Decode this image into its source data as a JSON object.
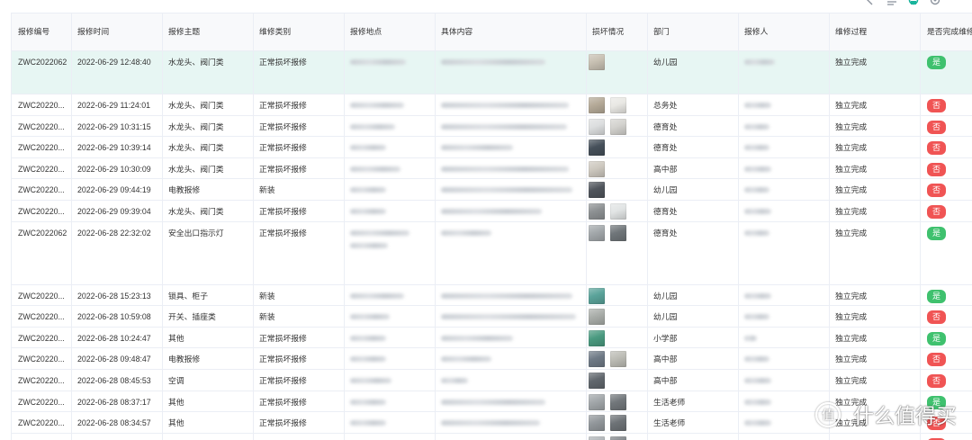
{
  "toolbar": {
    "icons": [
      "prev-icon",
      "density-icon",
      "refresh-icon",
      "settings-icon"
    ],
    "accent": "#19b49c"
  },
  "columns": [
    "报修编号",
    "报修时间",
    "报修主题",
    "维修类别",
    "报修地点",
    "具体内容",
    "损坏情况",
    "部门",
    "报修人",
    "维修过程",
    "是否完成维修"
  ],
  "status_colors": {
    "是": "#3fc16e",
    "否": "#f05454"
  },
  "selected_row_color": "#e7f6f3",
  "rows": [
    {
      "id": "ZWC2022062",
      "time": "2022-06-29 12:48:40",
      "subject": "水龙头、阀门类",
      "category": "正常损坏报修",
      "photos": [
        "#c7c0b2"
      ],
      "dept": "幼儿园",
      "process": "独立完成",
      "done": "是",
      "selected": true
    },
    {
      "id": "ZWC20220...",
      "time": "2022-06-29 11:24:01",
      "subject": "水龙头、阀门类",
      "category": "正常损坏报修",
      "photos": [
        "#b5aa98",
        "#e9e8e4"
      ],
      "dept": "总务处",
      "process": "独立完成",
      "done": "否"
    },
    {
      "id": "ZWC20220...",
      "time": "2022-06-29 10:31:15",
      "subject": "水龙头、阀门类",
      "category": "正常损坏报修",
      "photos": [
        "#dcdedf",
        "#d3d2ce"
      ],
      "dept": "德育处",
      "process": "独立完成",
      "done": "否"
    },
    {
      "id": "ZWC20220...",
      "time": "2022-06-29 10:39:14",
      "subject": "水龙头、阀门类",
      "category": "正常损坏报修",
      "photos": [
        "#46505a"
      ],
      "dept": "德育处",
      "process": "独立完成",
      "done": "否"
    },
    {
      "id": "ZWC20220...",
      "time": "2022-06-29 10:30:09",
      "subject": "水龙头、阀门类",
      "category": "正常损坏报修",
      "photos": [
        "#cdc8bf"
      ],
      "dept": "高中部",
      "process": "独立完成",
      "done": "否"
    },
    {
      "id": "ZWC20220...",
      "time": "2022-06-29 09:44:19",
      "subject": "电教报修",
      "category": "新装",
      "photos": [
        "#50555c"
      ],
      "dept": "幼儿园",
      "process": "独立完成",
      "done": "否"
    },
    {
      "id": "ZWC20220...",
      "time": "2022-06-29 09:39:04",
      "subject": "水龙头、阀门类",
      "category": "正常损坏报修",
      "photos": [
        "#8d9193",
        "#e1e4e4"
      ],
      "dept": "德育处",
      "process": "独立完成",
      "done": "否"
    },
    {
      "id": "ZWC2022062",
      "time": "2022-06-28 22:32:02",
      "subject": "安全出口指示灯",
      "category": "正常损坏报修",
      "photos": [
        "#a3a8ab",
        "#70767a"
      ],
      "dept": "德育处",
      "process": "独立完成",
      "done": "是"
    },
    {
      "id": "ZWC20220...",
      "time": "2022-06-28 15:23:13",
      "subject": "锁具、柜子",
      "category": "新装",
      "photos": [
        "#5aa39a"
      ],
      "dept": "幼儿园",
      "process": "独立完成",
      "done": "是"
    },
    {
      "id": "ZWC20220...",
      "time": "2022-06-28 10:59:08",
      "subject": "开关、插座类",
      "category": "新装",
      "photos": [
        "#a9ada9"
      ],
      "dept": "幼儿园",
      "process": "独立完成",
      "done": "否"
    },
    {
      "id": "ZWC20220...",
      "time": "2022-06-28 10:24:47",
      "subject": "其他",
      "category": "正常损坏报修",
      "photos": [
        "#4a9a80"
      ],
      "dept": "小学部",
      "process": "独立完成",
      "done": "是"
    },
    {
      "id": "ZWC20220...",
      "time": "2022-06-28 09:48:47",
      "subject": "电教报修",
      "category": "正常损坏报修",
      "photos": [
        "#6f7a86",
        "#bcbcb5"
      ],
      "dept": "高中部",
      "process": "独立完成",
      "done": "否"
    },
    {
      "id": "ZWC20220...",
      "time": "2022-06-28 08:45:53",
      "subject": "空调",
      "category": "正常损坏报修",
      "photos": [
        "#61676d"
      ],
      "dept": "高中部",
      "process": "独立完成",
      "done": "否"
    },
    {
      "id": "ZWC20220...",
      "time": "2022-06-28 08:37:17",
      "subject": "其他",
      "category": "正常损坏报修",
      "photos": [
        "#a2a7aa",
        "#72777b"
      ],
      "dept": "生活老师",
      "process": "独立完成",
      "done": "是"
    },
    {
      "id": "ZWC20220...",
      "time": "2022-06-28 08:34:57",
      "subject": "其他",
      "category": "正常损坏报修",
      "photos": [
        "#93989c",
        "#6e7377"
      ],
      "dept": "生活老师",
      "process": "独立完成",
      "done": "否"
    }
  ],
  "partial_row": {
    "photos": [
      "#aeb3b6",
      "#7f8488"
    ],
    "done_color": "#f05454"
  },
  "watermark": {
    "icon": "值",
    "text": "什么值得买"
  }
}
